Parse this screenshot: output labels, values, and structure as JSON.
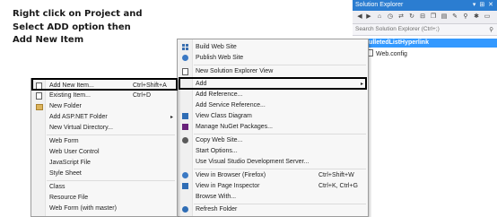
{
  "instruction": {
    "lines": [
      "Right click on Project and",
      "Select ADD option then",
      "Add New Item"
    ]
  },
  "solution_explorer": {
    "title": "Solution Explorer",
    "title_buttons": "▾ ⊞ ✕",
    "search_placeholder": "Search Solution Explorer (Ctrl+;)",
    "project_name": "BulletedListHyperlink",
    "files": [
      "Web.config"
    ]
  },
  "project_menu": {
    "items": [
      {
        "label": "Build Web Site",
        "shortcut": "",
        "icon": "build-icon"
      },
      {
        "label": "Publish Web Site",
        "shortcut": "",
        "icon": "publish-icon"
      },
      {
        "label": "New Solution Explorer View",
        "shortcut": "",
        "icon": "new-view-icon"
      },
      {
        "label": "Add",
        "shortcut": "",
        "icon": "",
        "submenu": true
      },
      {
        "label": "Add Reference...",
        "shortcut": "",
        "icon": ""
      },
      {
        "label": "Add Service Reference...",
        "shortcut": "",
        "icon": ""
      },
      {
        "label": "View Class Diagram",
        "shortcut": "",
        "icon": "class-diagram-icon"
      },
      {
        "label": "Manage NuGet Packages...",
        "shortcut": "",
        "icon": "nuget-icon"
      },
      {
        "label": "Copy Web Site...",
        "shortcut": "",
        "icon": "copy-web-icon"
      },
      {
        "label": "Start Options...",
        "shortcut": "",
        "icon": ""
      },
      {
        "label": "Use Visual Studio Development Server...",
        "shortcut": "",
        "icon": ""
      },
      {
        "label": "View in Browser (Firefox)",
        "shortcut": "Ctrl+Shift+W",
        "icon": "browser-icon"
      },
      {
        "label": "View in Page Inspector",
        "shortcut": "Ctrl+K, Ctrl+G",
        "icon": "inspector-icon"
      },
      {
        "label": "Browse With...",
        "shortcut": "",
        "icon": ""
      },
      {
        "label": "Refresh Folder",
        "shortcut": "",
        "icon": "refresh-icon"
      }
    ],
    "submenu_arrow": "▸"
  },
  "add_menu": {
    "items": [
      {
        "label": "Add New Item...",
        "shortcut": "Ctrl+Shift+A",
        "icon": "new-item-icon"
      },
      {
        "label": "Existing Item...",
        "shortcut": "Ctrl+D",
        "icon": "existing-item-icon"
      },
      {
        "label": "New Folder",
        "shortcut": "",
        "icon": "folder-icon"
      },
      {
        "label": "Add ASP.NET Folder",
        "shortcut": "",
        "icon": "",
        "submenu": true
      },
      {
        "label": "New Virtual Directory...",
        "shortcut": "",
        "icon": ""
      },
      {
        "label": "Web Form",
        "shortcut": "",
        "icon": ""
      },
      {
        "label": "Web User Control",
        "shortcut": "",
        "icon": ""
      },
      {
        "label": "JavaScript File",
        "shortcut": "",
        "icon": ""
      },
      {
        "label": "Style Sheet",
        "shortcut": "",
        "icon": ""
      },
      {
        "label": "Class",
        "shortcut": "",
        "icon": ""
      },
      {
        "label": "Resource File",
        "shortcut": "",
        "icon": ""
      },
      {
        "label": "Web Form (with master)",
        "shortcut": "",
        "icon": ""
      }
    ],
    "submenu_arrow": "▸"
  }
}
